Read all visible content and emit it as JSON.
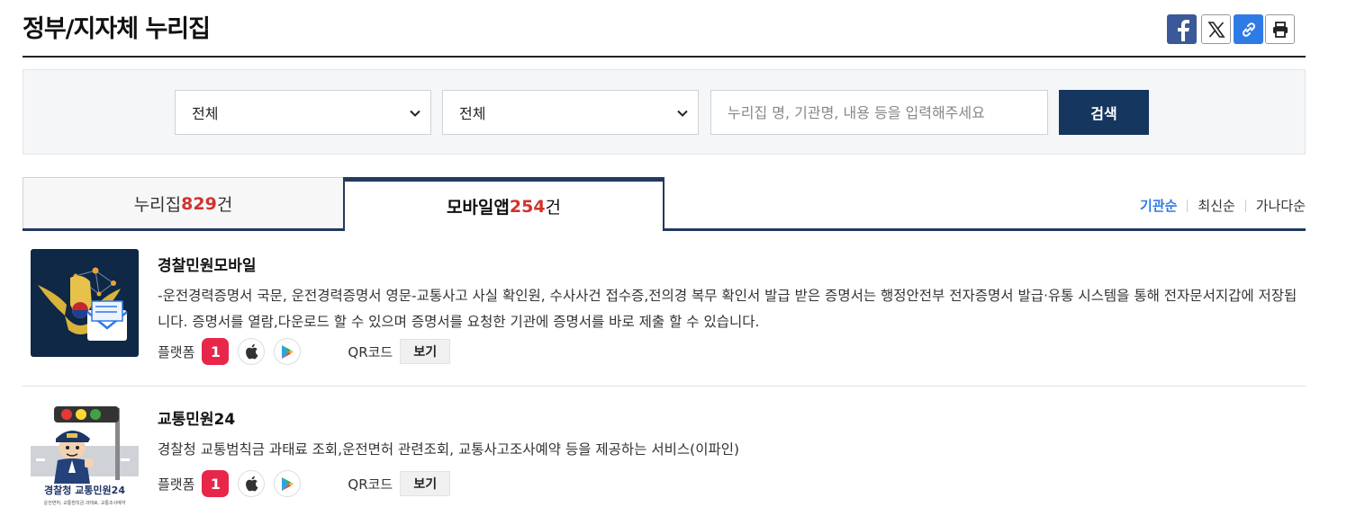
{
  "header": {
    "title": "정부/지자체 누리집"
  },
  "share": {
    "facebook_icon": "facebook-icon",
    "x_icon": "x-icon",
    "link_icon": "link-icon",
    "print_icon": "print-icon"
  },
  "search": {
    "select1": "전체",
    "select2": "전체",
    "placeholder": "누리집 명, 기관명, 내용 등을 입력해주세요",
    "button": "검색"
  },
  "tabs": [
    {
      "label": "누리집 ",
      "count": "829",
      "suffix": "건",
      "active": false
    },
    {
      "label": "모바일앱 ",
      "count": "254",
      "suffix": "건",
      "active": true
    }
  ],
  "sort": [
    {
      "label": "기관순",
      "active": true
    },
    {
      "label": "최신순",
      "active": false
    },
    {
      "label": "가나다순",
      "active": false
    }
  ],
  "apps": [
    {
      "name": "경찰민원모바일",
      "description": "-운전경력증명서 국문, 운전경력증명서 영문-교통사고 사실 확인원, 수사사건 접수증,전의경 복무 확인서 발급 받은 증명서는 행정안전부 전자증명서 발급·유통 시스템을 통해 전자문서지갑에 저장됩니다. 증명서를 열람,다운로드 할 수 있으며 증명서를 요청한 기관에 증명서를 바로 제출 할 수 있습니다.",
      "platform_label": "플랫폼",
      "onestore_label": "1",
      "qr_label": "QR코드",
      "qr_button": "보기"
    },
    {
      "name": "교통민원24",
      "description": "경찰청 교통범칙금 과태료 조회,운전면허 관련조회, 교통사고조사예약 등을 제공하는 서비스(이파인)",
      "platform_label": "플랫폼",
      "onestore_label": "1",
      "qr_label": "QR코드",
      "qr_button": "보기",
      "logo_text": "경찰청 교통민원24",
      "logo_subtext": "운전면허, 교통범칙금·과태료, 교통조사예약"
    }
  ],
  "colors": {
    "accent_navy": "#15365e",
    "count_red": "#d0342c",
    "sort_active": "#2f7be5"
  }
}
